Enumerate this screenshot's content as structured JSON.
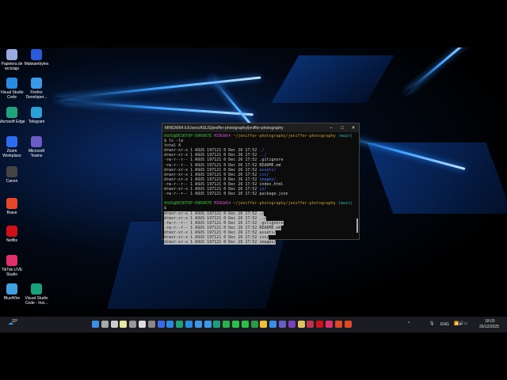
{
  "desktop_icons": [
    {
      "label": "Papelera de reciclaje",
      "color": "#9ad"
    },
    {
      "label": "Malwarebytes",
      "color": "#2b5bd8"
    },
    {
      "label": "Visual Studio Code",
      "color": "#2a8ce0"
    },
    {
      "label": "Firefox Developer...",
      "color": "#3a9ae8"
    },
    {
      "label": "Microsoft Edge",
      "color": "#1ea37a"
    },
    {
      "label": "Telegram",
      "color": "#2aa0d8"
    },
    {
      "label": "Zoom Workplace",
      "color": "#2d6cf0"
    },
    {
      "label": "Microsoft Teams",
      "color": "#6b5bc8"
    },
    {
      "label": "Canon",
      "color": "#444"
    },
    {
      "label": "Brave",
      "color": "#e4482a"
    },
    {
      "label": "Netflix",
      "color": "#d01018"
    },
    {
      "label": "TikTok LIVE Studio",
      "color": "#e0306a"
    },
    {
      "label": "BlueWire",
      "color": "#40a0e0"
    },
    {
      "label": "Visual Studio Code - Insi...",
      "color": "#1aa07a"
    }
  ],
  "terminal": {
    "title": "MINGW64:/c/Users/ASUS/jeniffer-photography/jeniffer-photography",
    "prompt_user": "ASUS@DESKTOP-D9RVB7E",
    "prompt_shell": "MINGW64",
    "prompt_path": "~/jeniffer-photography/jeniffer-photography",
    "prompt_branch": "(main)",
    "command": "$ ls -la",
    "total": "total 4",
    "listing": [
      {
        "meta": "drwxr-xr-x 1 ASUS 197121 0 Dec 26 17:52",
        "name": "./",
        "dir": true
      },
      {
        "meta": "drwxr-xr-x 1 ASUS 197121 0 Dec 26 17:52",
        "name": "../",
        "dir": true
      },
      {
        "meta": "-rw-r--r-- 1 ASUS 197121 0 Dec 26 17:52",
        "name": ".gitignore",
        "dir": false
      },
      {
        "meta": "-rw-r--r-- 1 ASUS 197121 0 Dec 26 17:52",
        "name": "README.md",
        "dir": false
      },
      {
        "meta": "drwxr-xr-x 1 ASUS 197121 0 Dec 26 17:52",
        "name": "assets/",
        "dir": true
      },
      {
        "meta": "drwxr-xr-x 1 ASUS 197121 0 Dec 26 17:52",
        "name": "css/",
        "dir": true
      },
      {
        "meta": "drwxr-xr-x 1 ASUS 197121 0 Dec 26 17:52",
        "name": "images/",
        "dir": true
      },
      {
        "meta": "-rw-r--r-- 1 ASUS 197121 0 Dec 26 17:52",
        "name": "index.html",
        "dir": false
      },
      {
        "meta": "drwxr-xr-x 1 ASUS 197121 0 Dec 26 17:52",
        "name": "js/",
        "dir": true
      },
      {
        "meta": "-rw-r--r-- 1 ASUS 197121 0 Dec 26 17:52",
        "name": "package.json",
        "dir": false
      }
    ],
    "prompt2_symbol": "$",
    "pasted": [
      "drwxr-xr-x 1 ASUS 197121 0 Dec 26 17:52 ./",
      "drwxr-xr-x 1 ASUS 197121 0 Dec 26 17:52 ../",
      "-rw-r--r-- 1 ASUS 197121 0 Dec 26 17:52 .gitignore",
      "-rw-r--r-- 1 ASUS 197121 0 Dec 26 17:52 README.md",
      "drwxr-xr-x 1 ASUS 197121 0 Dec 26 17:52 assets/",
      "drwxr-xr-x 1 ASUS 197121 0 Dec 26 17:52 css/",
      "drwxr-xr-x 1 ASUS 197121 0 Dec 26 17:52 images/"
    ]
  },
  "taskbar": {
    "weather": "20°",
    "apps": [
      "#3a8ee8",
      "#aaa",
      "#ccc",
      "#e8e8a0",
      "#999",
      "#ddd",
      "#888",
      "#3a6ae8",
      "#2a8ce0",
      "#1ea37a",
      "#2a8ce0",
      "#3a9ae8",
      "#3a9ae8",
      "#1aa07a",
      "#2ab04a",
      "#2ac04a",
      "#2ac04a",
      "#2a9a4a",
      "#f0c030",
      "#3a8ee8",
      "#6b5bc8",
      "#7a40c0",
      "#e0c060",
      "#c03050",
      "#d01018",
      "#e0306a",
      "#e04828",
      "#e4482a"
    ],
    "language": "ENG",
    "time": "18:03",
    "date": "26/12/2025"
  }
}
